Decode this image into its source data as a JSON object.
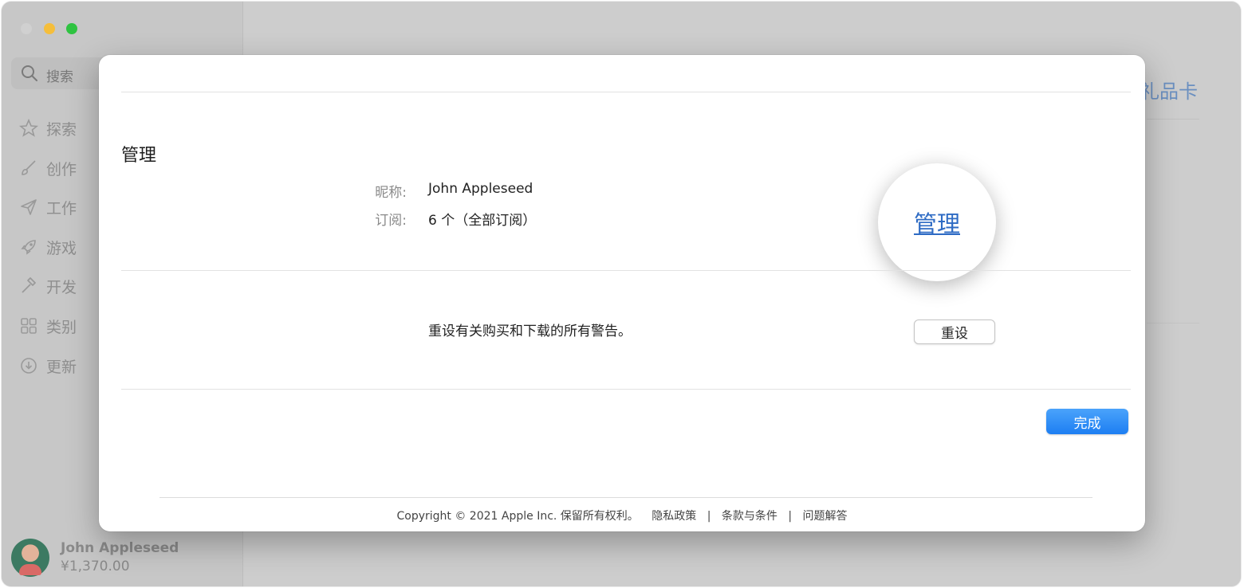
{
  "sidebar": {
    "search_placeholder": "搜索",
    "items": [
      {
        "label": "探索",
        "icon": "star-icon"
      },
      {
        "label": "创作",
        "icon": "brush-icon"
      },
      {
        "label": "工作",
        "icon": "paper-plane-icon"
      },
      {
        "label": "游戏",
        "icon": "rocket-icon"
      },
      {
        "label": "开发",
        "icon": "hammer-icon"
      },
      {
        "label": "类别",
        "icon": "grid-icon"
      },
      {
        "label": "更新",
        "icon": "download-icon"
      }
    ],
    "account": {
      "name": "John Appleseed",
      "balance": "¥1,370.00"
    }
  },
  "background": {
    "gift_card_fragment": "礼品卡"
  },
  "sheet": {
    "section_title": "管理",
    "nickname_label": "昵称:",
    "nickname_value": "John Appleseed",
    "subscriptions_label": "订阅:",
    "subscriptions_value": "6 个（全部订阅）",
    "manage_link": "管理",
    "reset_text": "重设有关购买和下载的所有警告。",
    "reset_button": "重设",
    "done_button": "完成",
    "footer": {
      "copyright": "Copyright © 2021 Apple Inc. 保留所有权利。",
      "links": [
        "隐私政策",
        "条款与条件",
        "问题解答"
      ],
      "separator": "|"
    }
  },
  "colors": {
    "accent": "#2e6bc4",
    "done_button": "#1d7ef2",
    "traffic_min": "#f5be3b",
    "traffic_max": "#2fc341"
  }
}
